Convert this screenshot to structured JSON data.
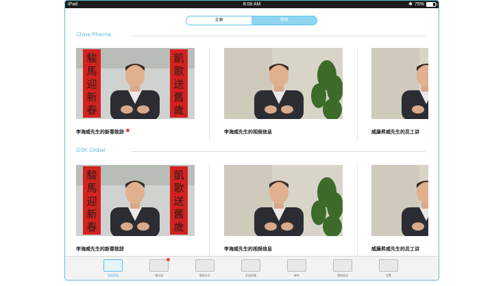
{
  "status_bar": {
    "carrier": "iPad",
    "time": "8:08 AM",
    "battery": "75%",
    "battery_level": 0.75
  },
  "segmented": {
    "tabs": [
      {
        "label": "文章",
        "active": true
      },
      {
        "label": "视频",
        "active": false
      }
    ]
  },
  "sections": [
    {
      "title": "China Pharma",
      "videos": [
        {
          "title": "李海威先生的新春致辞",
          "new": true,
          "scene": "banner"
        },
        {
          "title": "李海威先生的视频信息",
          "new": false,
          "scene": "plant"
        },
        {
          "title": "威廉昇威先生的员工讲",
          "new": false,
          "scene": "plant"
        }
      ]
    },
    {
      "title": "GSK Global",
      "videos": [
        {
          "title": "李海威先生的新春致辞",
          "new": false,
          "scene": "banner"
        },
        {
          "title": "李海威先生的视频信息",
          "new": false,
          "scene": "plant"
        },
        {
          "title": "威廉昇威先生的员工讲",
          "new": false,
          "scene": "plant"
        }
      ]
    }
  ],
  "tab_bar": {
    "items": [
      {
        "label": "视频频道",
        "icon": "video-list-icon",
        "active": true,
        "badge": false
      },
      {
        "label": "通讯录",
        "icon": "chat-icon",
        "active": false,
        "badge": true
      },
      {
        "label": "联系方式",
        "icon": "contact-card-icon",
        "active": false,
        "badge": false
      },
      {
        "label": "文档资源",
        "icon": "document-icon",
        "active": false,
        "badge": false
      },
      {
        "label": "邮件",
        "icon": "mail-icon",
        "active": false,
        "badge": false
      },
      {
        "label": "我的会议",
        "icon": "people-icon",
        "active": false,
        "badge": false
      },
      {
        "label": "设置",
        "icon": "gear-icon",
        "active": false,
        "badge": false
      }
    ]
  },
  "colors": {
    "accent": "#5bbfdc",
    "banner_red": "#d22222",
    "badge": "#e04545"
  }
}
